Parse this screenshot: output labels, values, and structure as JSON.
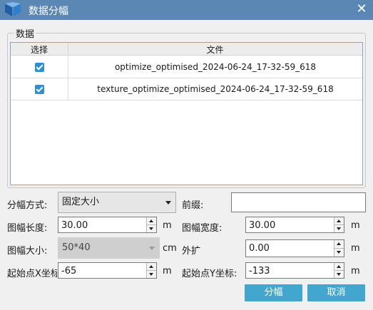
{
  "window": {
    "title": "数据分幅",
    "close": "✕"
  },
  "group": {
    "title": "数据"
  },
  "table": {
    "headers": [
      "选择",
      "文件"
    ],
    "rows": [
      {
        "checked": true,
        "file": "optimize_optimised_2024-06-24_17-32-59_618"
      },
      {
        "checked": true,
        "file": "texture_optimize_optimised_2024-06-24_17-32-59_618"
      }
    ]
  },
  "form": {
    "split_mode_label": "分幅方式:",
    "split_mode_value": "固定大小",
    "prefix_label": "前缀:",
    "prefix_value": "",
    "length_label": "图幅长度:",
    "length_value": "30.00",
    "length_unit": "m",
    "width_label": "图幅宽度:",
    "width_value": "30.00",
    "width_unit": "m",
    "size_label": "图幅大小:",
    "size_value": "50*40",
    "size_unit": "cm",
    "expand_label": "外扩",
    "expand_value": "0.00",
    "expand_unit": "m",
    "start_x_label": "起始点X坐标",
    "start_x_value": "-65",
    "start_x_unit": "m",
    "start_y_label": "起始点Y坐标:",
    "start_y_value": "-133",
    "start_y_unit": "m"
  },
  "buttons": {
    "ok": "分幅",
    "cancel": "取消"
  },
  "colors": {
    "titlebar": "#5b87b5",
    "button": "#41a7cf",
    "checkbox": "#2f8fd6"
  }
}
